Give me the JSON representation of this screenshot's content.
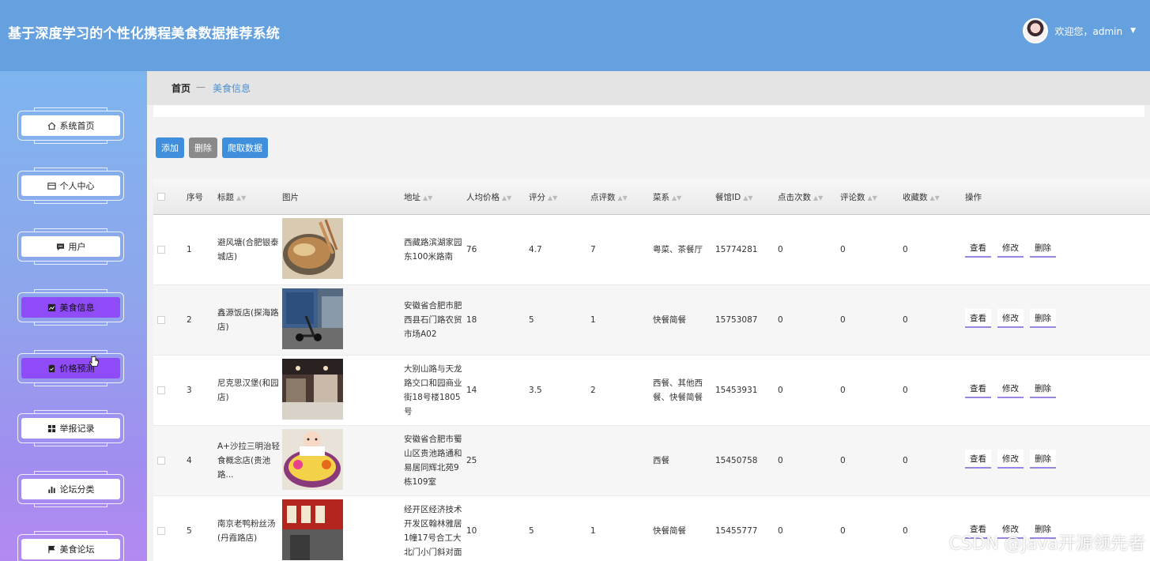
{
  "header": {
    "title": "基于深度学习的个性化携程美食数据推荐系统",
    "welcome": "欢迎您，admin"
  },
  "sidebar": {
    "items": [
      {
        "label": "系统首页",
        "icon": "home-icon",
        "active": false
      },
      {
        "label": "个人中心",
        "icon": "user-card-icon",
        "active": false
      },
      {
        "label": "用户",
        "icon": "chat-icon",
        "active": false
      },
      {
        "label": "美食信息",
        "icon": "chart-icon",
        "active": true
      },
      {
        "label": "价格预测",
        "icon": "clipboard-icon",
        "active": true
      },
      {
        "label": "举报记录",
        "icon": "grid-icon",
        "active": false
      },
      {
        "label": "论坛分类",
        "icon": "bar-chart-icon",
        "active": false
      },
      {
        "label": "美食论坛",
        "icon": "flag-icon",
        "active": false
      }
    ]
  },
  "breadcrumb": {
    "home": "首页",
    "separator": "—",
    "current": "美食信息"
  },
  "toolbar": {
    "add": "添加",
    "delete": "删除",
    "crawl": "爬取数据"
  },
  "table": {
    "headers": [
      "序号",
      "标题",
      "图片",
      "地址",
      "人均价格",
      "评分",
      "点评数",
      "菜系",
      "餐馆ID",
      "点击次数",
      "评论数",
      "收藏数",
      "操作"
    ],
    "rows": [
      {
        "no": "1",
        "title": "避风塘(合肥银泰城店)",
        "address": "西藏路滨湖家园东100米路南",
        "price": "76",
        "rating": "4.7",
        "reviews": "7",
        "cuisine": "粤菜、茶餐厅",
        "rid": "15774281",
        "clicks": "0",
        "comments": "0",
        "favorites": "0"
      },
      {
        "no": "2",
        "title": "鑫源饭店(探海路店)",
        "address": "安徽省合肥市肥西县石门路农贸市场A02",
        "price": "18",
        "rating": "5",
        "reviews": "1",
        "cuisine": "快餐简餐",
        "rid": "15753087",
        "clicks": "0",
        "comments": "0",
        "favorites": "0"
      },
      {
        "no": "3",
        "title": "尼克思汉堡(和园店)",
        "address": "大别山路与天龙路交口和园商业街18号楼1805号",
        "price": "14",
        "rating": "3.5",
        "reviews": "2",
        "cuisine": "西餐、其他西餐、快餐简餐",
        "rid": "15453931",
        "clicks": "0",
        "comments": "0",
        "favorites": "0"
      },
      {
        "no": "4",
        "title": "A+沙拉三明治轻食概念店(贵池路...",
        "address": "安徽省合肥市蜀山区贵池路通和易居同辉北苑9栋109室",
        "price": "25",
        "rating": "",
        "reviews": "",
        "cuisine": "西餐",
        "rid": "15450758",
        "clicks": "0",
        "comments": "0",
        "favorites": "0"
      },
      {
        "no": "5",
        "title": "南京老鸭粉丝汤(丹霞路店)",
        "address": "经开区经济技术开发区翰林雅居1幢17号合工大北门小门斜对面",
        "price": "10",
        "rating": "5",
        "reviews": "1",
        "cuisine": "快餐简餐",
        "rid": "15455777",
        "clicks": "0",
        "comments": "0",
        "favorites": "0"
      }
    ],
    "ops": {
      "view": "查看",
      "edit": "修改",
      "delete": "删除"
    }
  },
  "watermark": "CSDN @Java开源领先者"
}
